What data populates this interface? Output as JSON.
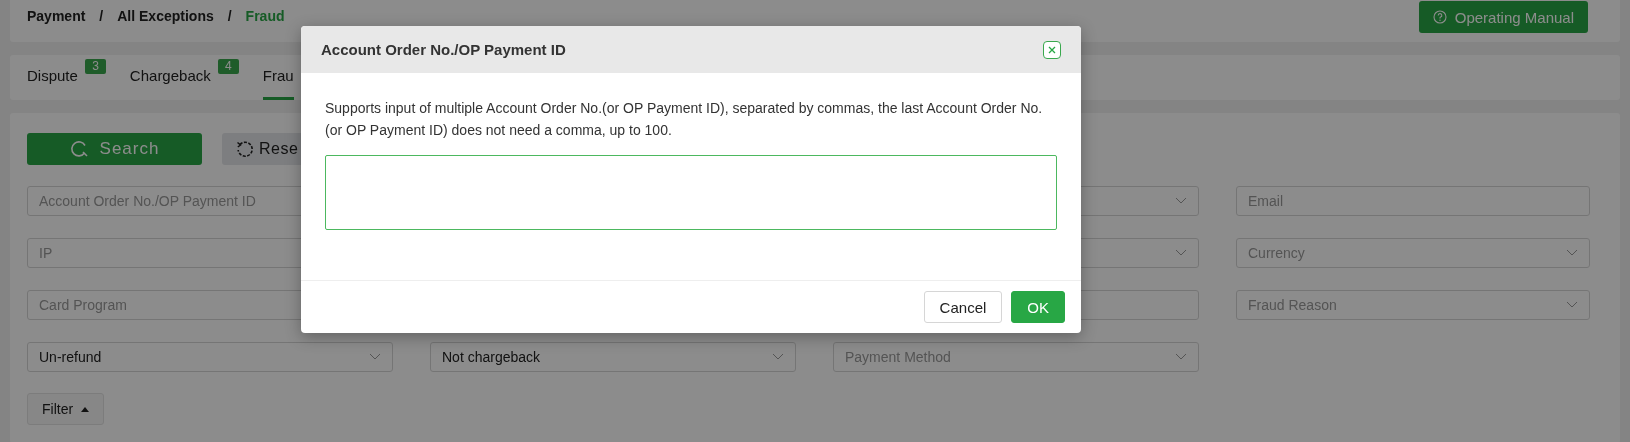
{
  "breadcrumb": [
    {
      "kind": "link",
      "label": "Payment",
      "current": false
    },
    {
      "kind": "separator",
      "label": "/"
    },
    {
      "kind": "link",
      "label": "All Exceptions",
      "current": false
    },
    {
      "kind": "separator",
      "label": "/"
    },
    {
      "kind": "link",
      "label": "Fraud",
      "current": true
    }
  ],
  "manual_button": {
    "label": "Operating Manual"
  },
  "tabs": [
    {
      "label": "Dispute",
      "badge": "3",
      "selected": false
    },
    {
      "label": "Chargeback",
      "badge": "4",
      "selected": false
    },
    {
      "label": "Frau",
      "selected": true
    }
  ],
  "actions": [
    {
      "kind": "search",
      "label": "Search"
    },
    {
      "kind": "reset",
      "label": "Rese"
    }
  ],
  "filters": {
    "rows": [
      [
        {
          "kind": "input",
          "placeholder": "Account Order No./OP Payment ID"
        },
        null,
        {
          "kind": "select"
        },
        {
          "kind": "input",
          "placeholder": "Email"
        }
      ],
      [
        {
          "kind": "input",
          "placeholder": "IP"
        },
        null,
        {
          "kind": "select"
        },
        {
          "kind": "select",
          "placeholder": "Currency"
        }
      ],
      [
        {
          "kind": "input",
          "placeholder": "Card Program"
        },
        null,
        {
          "kind": "input"
        },
        {
          "kind": "select",
          "placeholder": "Fraud Reason"
        }
      ],
      [
        {
          "kind": "select",
          "value": "Un-refund"
        },
        {
          "kind": "select",
          "value": "Not chargeback"
        },
        {
          "kind": "select",
          "placeholder": "Payment Method"
        },
        null
      ]
    ]
  },
  "filter_toggle": {
    "label": "Filter",
    "expanded": true
  },
  "dialog": {
    "title": "Account Order No./OP Payment ID",
    "message": "Supports input of multiple Account Order No.(or OP Payment ID), separated by commas, the last Account Order No.(or OP Payment ID) does not need a comma, up to 100.",
    "buttons": [
      {
        "kind": "secondary",
        "label": "Cancel"
      },
      {
        "kind": "primary",
        "label": "OK"
      }
    ]
  }
}
